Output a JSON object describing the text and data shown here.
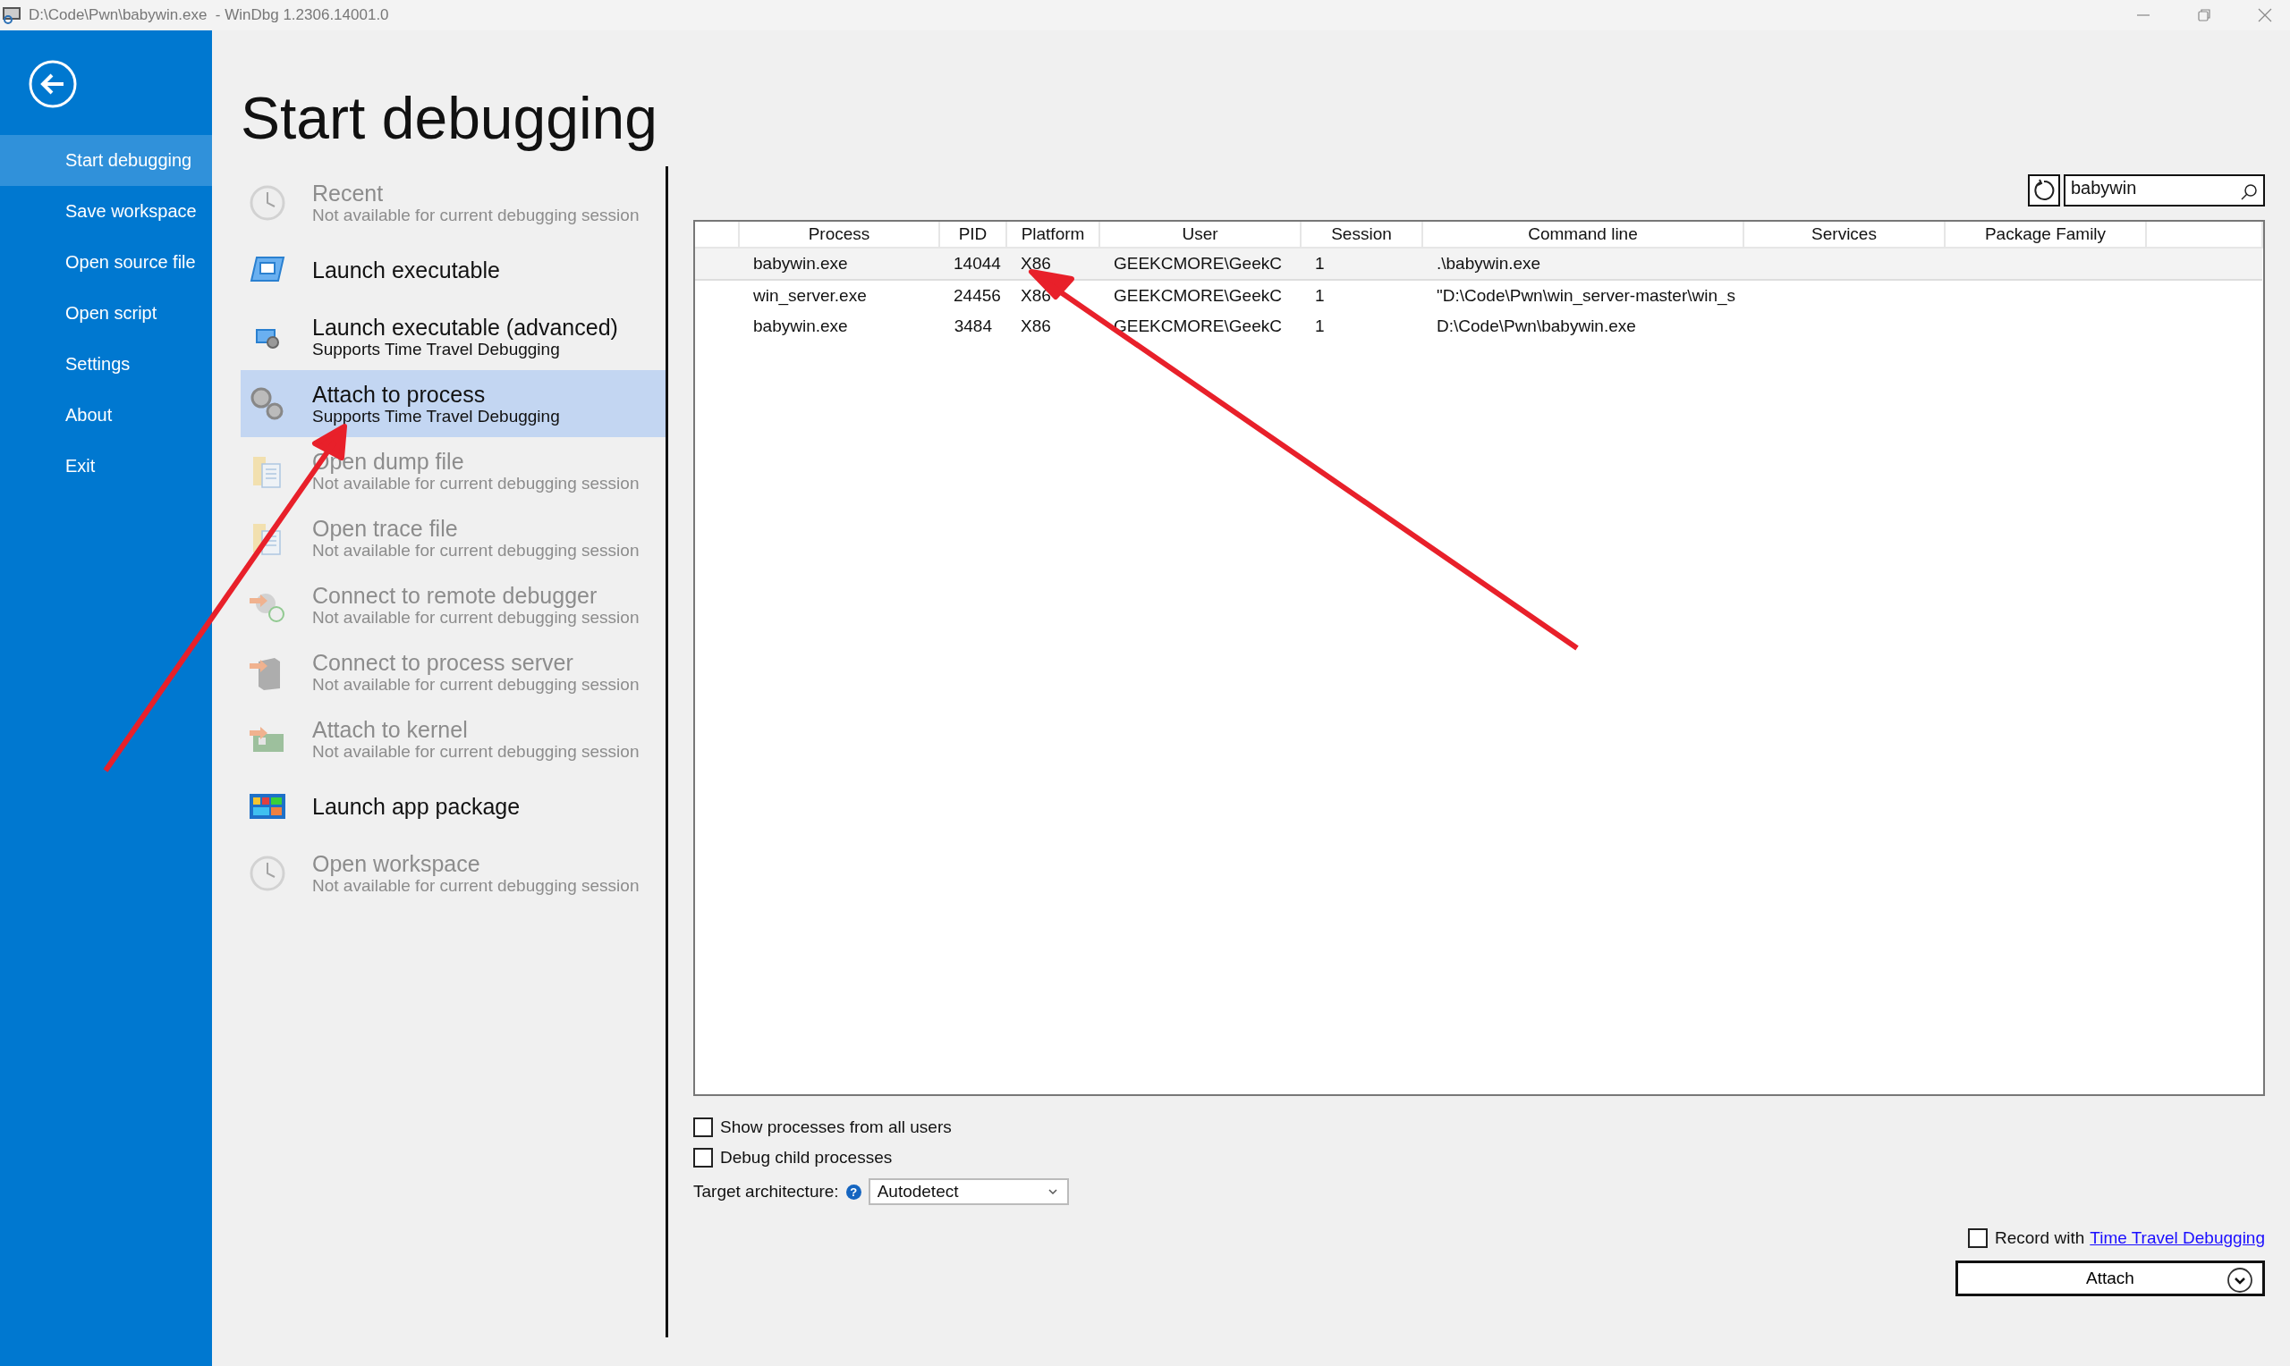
{
  "window": {
    "title": "D:\\Code\\Pwn\\babywin.exe  - WinDbg 1.2306.14001.0"
  },
  "sidebar": {
    "items": [
      {
        "label": "Start debugging",
        "selected": true
      },
      {
        "label": "Save workspace",
        "selected": false
      },
      {
        "label": "Open source file",
        "selected": false
      },
      {
        "label": "Open script",
        "selected": false
      },
      {
        "label": "Settings",
        "selected": false
      },
      {
        "label": "About",
        "selected": false
      },
      {
        "label": "Exit",
        "selected": false
      }
    ]
  },
  "heading": "Start debugging",
  "options": [
    {
      "title": "Recent",
      "subtitle": "Not available for current debugging session",
      "disabled": true,
      "selected": false
    },
    {
      "title": "Launch executable",
      "disabled": false,
      "selected": false
    },
    {
      "title": "Launch executable (advanced)",
      "subtitle": "Supports Time Travel Debugging",
      "disabled": false,
      "selected": false
    },
    {
      "title": "Attach to process",
      "subtitle": "Supports Time Travel Debugging",
      "disabled": false,
      "selected": true
    },
    {
      "title": "Open dump file",
      "subtitle": "Not available for current debugging session",
      "disabled": true,
      "selected": false
    },
    {
      "title": "Open trace file",
      "subtitle": "Not available for current debugging session",
      "disabled": true,
      "selected": false
    },
    {
      "title": "Connect to remote debugger",
      "subtitle": "Not available for current debugging session",
      "disabled": true,
      "selected": false
    },
    {
      "title": "Connect to process server",
      "subtitle": "Not available for current debugging session",
      "disabled": true,
      "selected": false
    },
    {
      "title": "Attach to kernel",
      "subtitle": "Not available for current debugging session",
      "disabled": true,
      "selected": false
    },
    {
      "title": "Launch app package",
      "disabled": false,
      "selected": false
    },
    {
      "title": "Open workspace",
      "subtitle": "Not available for current debugging session",
      "disabled": true,
      "selected": false
    }
  ],
  "search": {
    "value": "babywin"
  },
  "table": {
    "columns": [
      "Process",
      "PID",
      "Platform",
      "User",
      "Session",
      "Command line",
      "Services",
      "Package Family"
    ],
    "rows": [
      {
        "cells": [
          "babywin.exe",
          "14044",
          "X86",
          "GEEKCMORE\\GeekC",
          "1",
          ".\\babywin.exe"
        ],
        "selected": true
      },
      {
        "cells": [
          "win_server.exe",
          "24456",
          "X86",
          "GEEKCMORE\\GeekC",
          "1",
          "\"D:\\Code\\Pwn\\win_server-master\\win_s"
        ],
        "selected": false
      },
      {
        "cells": [
          "babywin.exe",
          "3484",
          "X86",
          "GEEKCMORE\\GeekC",
          "1",
          "D:\\Code\\Pwn\\babywin.exe"
        ],
        "selected": false
      }
    ]
  },
  "checkboxes": [
    {
      "label": "Show processes from all users",
      "checked": false
    },
    {
      "label": "Debug child processes",
      "checked": false
    }
  ],
  "target_architecture": {
    "label": "Target architecture:",
    "help": "?",
    "value": "Autodetect"
  },
  "record": {
    "label": "Record with",
    "link": "Time Travel Debugging",
    "checked": false
  },
  "attach_button": "Attach"
}
